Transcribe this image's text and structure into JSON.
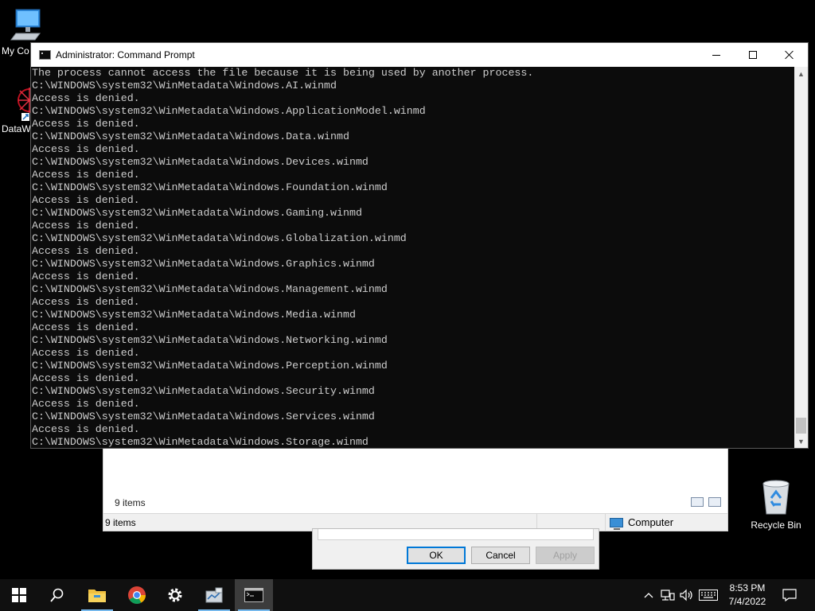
{
  "desktop": {
    "icons": [
      {
        "label": "My Co"
      },
      {
        "label": "DataW"
      },
      {
        "label": "Recycle Bin"
      }
    ]
  },
  "explorer": {
    "items_count": "9 items",
    "status_items": "9 items",
    "status_location": "Computer"
  },
  "dialog": {
    "ok_label": "OK",
    "cancel_label": "Cancel",
    "apply_label": "Apply"
  },
  "cmd": {
    "title": "Administrator: Command Prompt",
    "lines": [
      "The process cannot access the file because it is being used by another process.",
      "C:\\WINDOWS\\system32\\WinMetadata\\Windows.AI.winmd",
      "Access is denied.",
      "C:\\WINDOWS\\system32\\WinMetadata\\Windows.ApplicationModel.winmd",
      "Access is denied.",
      "C:\\WINDOWS\\system32\\WinMetadata\\Windows.Data.winmd",
      "Access is denied.",
      "C:\\WINDOWS\\system32\\WinMetadata\\Windows.Devices.winmd",
      "Access is denied.",
      "C:\\WINDOWS\\system32\\WinMetadata\\Windows.Foundation.winmd",
      "Access is denied.",
      "C:\\WINDOWS\\system32\\WinMetadata\\Windows.Gaming.winmd",
      "Access is denied.",
      "C:\\WINDOWS\\system32\\WinMetadata\\Windows.Globalization.winmd",
      "Access is denied.",
      "C:\\WINDOWS\\system32\\WinMetadata\\Windows.Graphics.winmd",
      "Access is denied.",
      "C:\\WINDOWS\\system32\\WinMetadata\\Windows.Management.winmd",
      "Access is denied.",
      "C:\\WINDOWS\\system32\\WinMetadata\\Windows.Media.winmd",
      "Access is denied.",
      "C:\\WINDOWS\\system32\\WinMetadata\\Windows.Networking.winmd",
      "Access is denied.",
      "C:\\WINDOWS\\system32\\WinMetadata\\Windows.Perception.winmd",
      "Access is denied.",
      "C:\\WINDOWS\\system32\\WinMetadata\\Windows.Security.winmd",
      "Access is denied.",
      "C:\\WINDOWS\\system32\\WinMetadata\\Windows.Services.winmd",
      "Access is denied.",
      "C:\\WINDOWS\\system32\\WinMetadata\\Windows.Storage.winmd"
    ]
  },
  "taskbar": {
    "time": "8:53 PM",
    "date": "7/4/2022",
    "accent_color": "#76b9ed",
    "pinned": [
      "windows-start-icon",
      "search-icon",
      "file-explorer-icon",
      "chrome-icon",
      "settings-gear-icon",
      "server-manager-icon",
      "command-prompt-icon"
    ]
  }
}
